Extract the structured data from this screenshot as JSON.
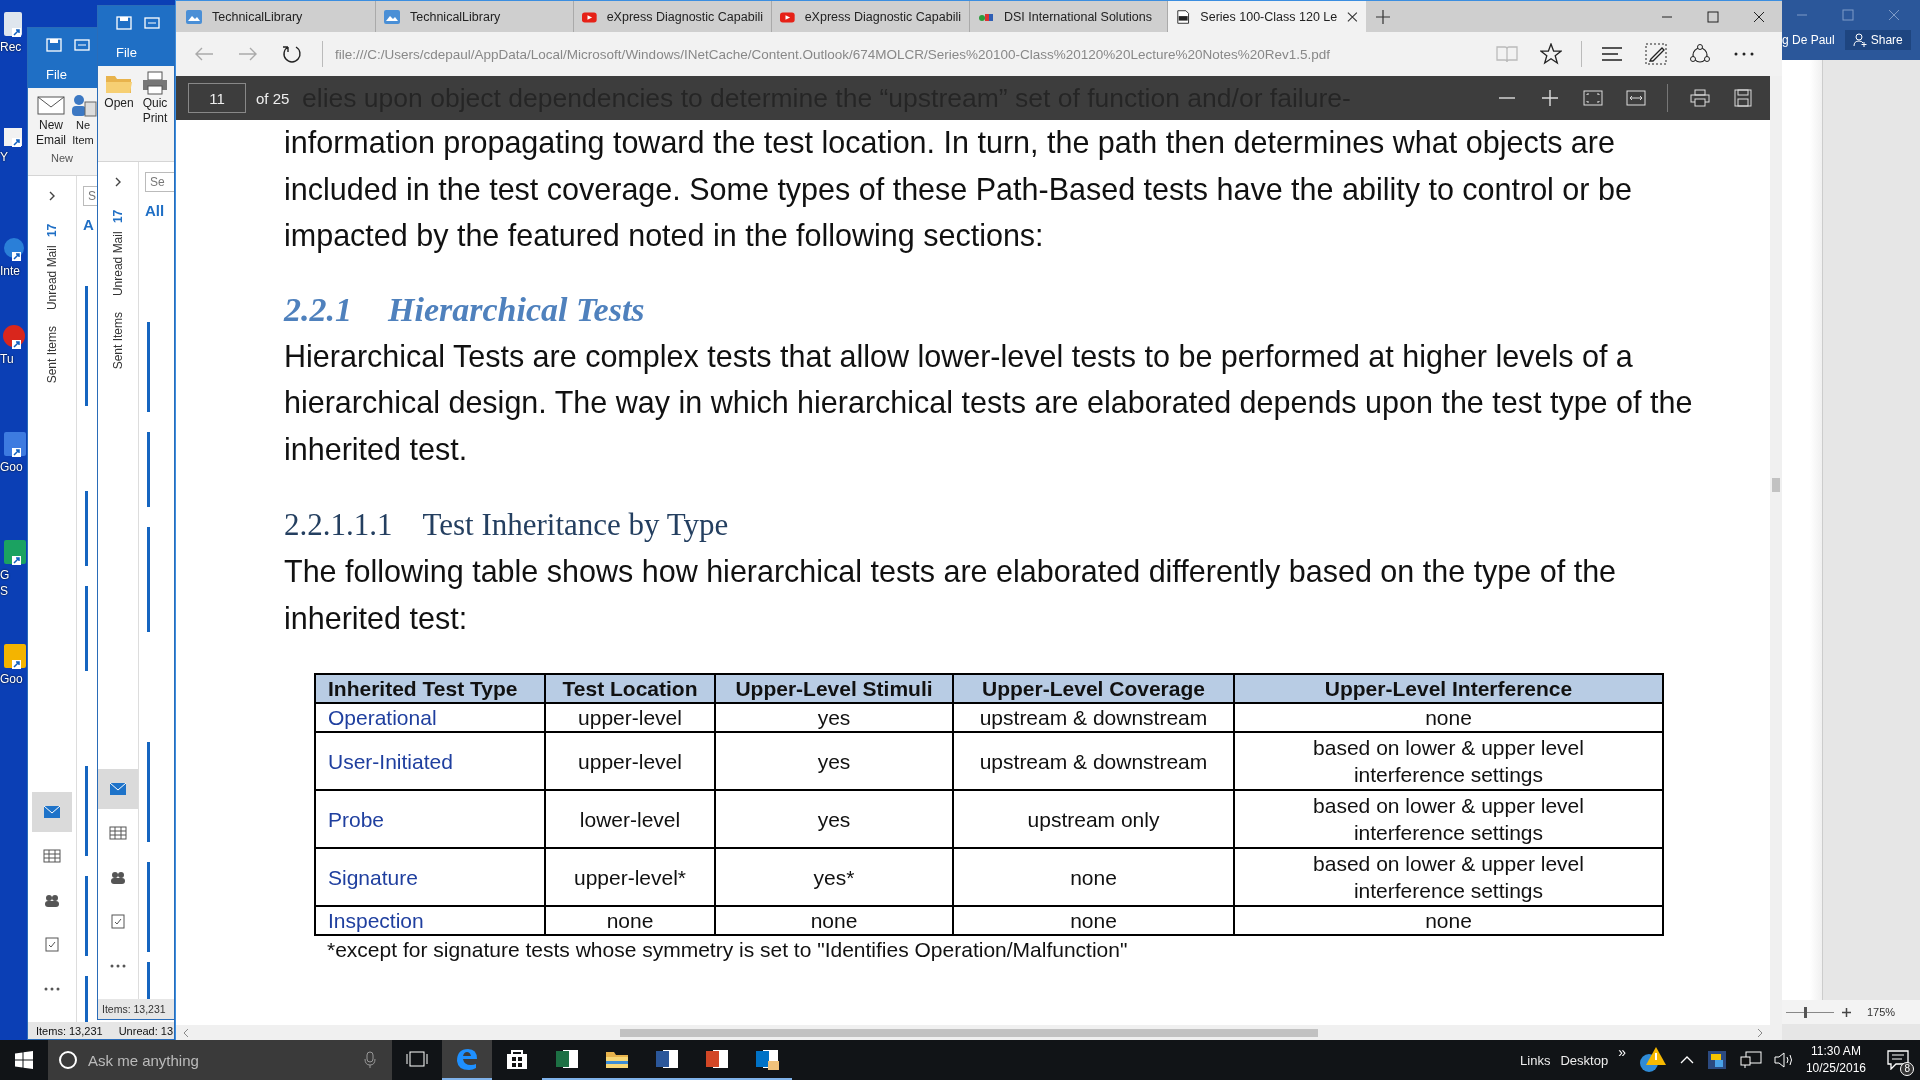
{
  "desktop_icons": [
    {
      "label": "Rec",
      "kind": "recycle"
    },
    {
      "label": "Y",
      "kind": "blank"
    },
    {
      "label": "Inte",
      "kind": "globe"
    },
    {
      "label": "Tu",
      "kind": "red"
    },
    {
      "label": "Goo",
      "kind": "blue"
    },
    {
      "label": "G",
      "kind": "green"
    },
    {
      "label": "S",
      "kind": "none"
    },
    {
      "label": "Goo",
      "kind": "yellow"
    }
  ],
  "outlook_windows": [
    {
      "file_tab": "File",
      "ribbon_buttons": [
        {
          "label": "New Email",
          "kind": "mail"
        },
        {
          "label": "Ne Item",
          "kind": "items"
        }
      ],
      "group_label": "New",
      "folders": [
        {
          "name": "Unread Mail",
          "count": "17"
        },
        {
          "name": "Sent Items"
        }
      ],
      "search_placeholder": "S",
      "list_header": "A",
      "nav_icons": [
        {
          "kind": "mail",
          "selected": true
        },
        {
          "kind": "calendar",
          "selected": false
        },
        {
          "kind": "people",
          "selected": false
        },
        {
          "kind": "tasks",
          "selected": false
        },
        {
          "kind": "more",
          "selected": false
        }
      ],
      "status": [
        "Items: 13,231",
        "Unread: 13"
      ]
    },
    {
      "file_tab": "File",
      "ribbon_buttons": [
        {
          "label": "Open",
          "kind": "folder"
        },
        {
          "label": "Quic Print",
          "kind": "printer"
        }
      ],
      "folders": [
        {
          "name": "Unread Mail",
          "count": "17"
        },
        {
          "name": "Sent Items"
        }
      ],
      "search_placeholder": "Se",
      "list_header": "All",
      "nav_icons": [
        {
          "kind": "mail",
          "selected": true
        },
        {
          "kind": "calendar",
          "selected": false
        },
        {
          "kind": "people",
          "selected": false
        },
        {
          "kind": "tasks",
          "selected": false
        },
        {
          "kind": "more",
          "selected": false
        }
      ],
      "status": [
        "Items: 13,231"
      ]
    }
  ],
  "browser": {
    "tabs": [
      {
        "title": "TechnicalLibrary",
        "kind": "cloud",
        "selected": false
      },
      {
        "title": "TechnicalLibrary",
        "kind": "cloud",
        "selected": false
      },
      {
        "title": "eXpress Diagnostic Capabili",
        "kind": "video",
        "selected": false
      },
      {
        "title": "eXpress Diagnostic Capabili",
        "kind": "video",
        "selected": false
      },
      {
        "title": "DSI International Solutions",
        "kind": "dsi",
        "selected": false
      },
      {
        "title": "Series 100-Class 120 Le",
        "kind": "pdf",
        "selected": true
      }
    ],
    "address": "file:///C:/Users/cdepaul/AppData/Local/Microsoft/Windows/INetCache/Content.Outlook/674MOLCR/Series%20100-Class%20120%20Lecture%20Notes%20Rev1.5.pdf",
    "pdf_toolbar": {
      "page": "11",
      "page_count": "of 25"
    }
  },
  "document": {
    "top_line": "elies upon object dependencies to determine the “upstream” set of function and/or failure-",
    "intro": "information propagating toward the test location.  In turn, the path then determines what objects are included in the test coverage.  Some types of these Path-Based tests have the ability to control or be impacted by the featured noted in the following sections:",
    "heading": {
      "number": "2.2.1",
      "title": "Hierarchical Tests"
    },
    "paragraph": "Hierarchical Tests are complex tests that allow lower-level tests to be performed at higher levels of a hierarchical design. The way in which hierarchical tests are elaborated depends upon the test type of the inherited test.",
    "subheading": {
      "number": "2.2.1.1.1",
      "title": "Test Inheritance by Type"
    },
    "paragraph2": "The following table shows how hierarchical tests are elaborated differently based on the type of the inherited test:",
    "table": {
      "columns": [
        "Inherited Test Type",
        "Test Location",
        "Upper-Level Stimuli",
        "Upper-Level Coverage",
        "Upper-Level Interference"
      ],
      "rows": [
        [
          "Operational",
          "upper-level",
          "yes",
          "upstream & downstream",
          "none"
        ],
        [
          "User-Initiated",
          "upper-level",
          "yes",
          "upstream & downstream",
          "based on lower & upper level interference settings"
        ],
        [
          "Probe",
          "lower-level",
          "yes",
          "upstream only",
          "based on lower & upper level interference settings"
        ],
        [
          "Signature",
          "upper-level*",
          "yes*",
          "none",
          "based on lower & upper level interference settings"
        ],
        [
          "Inspection",
          "none",
          "none",
          "none",
          "none"
        ]
      ]
    },
    "footnote": "*except for signature tests whose symmetry is set to \"Identifies Operation/Malfunction\""
  },
  "word": {
    "user": "g De Paul",
    "share": "Share",
    "zoom": "175%",
    "zoom_slider": {
      "level": 0.4
    }
  },
  "taskbar": {
    "search_placeholder": "Ask me anything",
    "apps": [
      {
        "kind": "edge",
        "active": true,
        "running": true
      },
      {
        "kind": "store",
        "active": false,
        "running": false
      },
      {
        "kind": "excel",
        "active": false,
        "running": true
      },
      {
        "kind": "explorer",
        "active": false,
        "running": true
      },
      {
        "kind": "word",
        "active": false,
        "running": true
      },
      {
        "kind": "powerpoint",
        "active": false,
        "running": true
      },
      {
        "kind": "outlook",
        "active": false,
        "running": true
      }
    ],
    "toolbars": [
      "Links",
      "Desktop"
    ],
    "overflow": "»",
    "time": "11:30 AM",
    "date": "10/25/2016",
    "notifications": "8"
  }
}
